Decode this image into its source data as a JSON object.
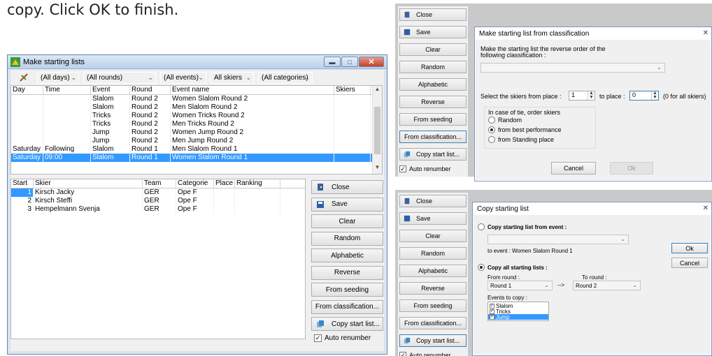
{
  "caption": "copy. Click OK to finish.",
  "main_window": {
    "title": "Make starting lists",
    "filters": [
      "(All days)",
      "(All rounds)",
      "(All events)",
      "All skiers",
      "(All categories)"
    ],
    "events_columns": [
      "Day",
      "Time",
      "Event",
      "Round",
      "Event name",
      "Skiers"
    ],
    "events_rows": [
      [
        "",
        "",
        "Slalom",
        "Round 2",
        "Women Slalom Round 2",
        ""
      ],
      [
        "",
        "",
        "Slalom",
        "Round 2",
        "Men Slalom Round 2",
        ""
      ],
      [
        "",
        "",
        "Tricks",
        "Round 2",
        "Women Tricks Round 2",
        ""
      ],
      [
        "",
        "",
        "Tricks",
        "Round 2",
        "Men Tricks Round 2",
        ""
      ],
      [
        "",
        "",
        "Jump",
        "Round 2",
        "Women Jump Round 2",
        ""
      ],
      [
        "",
        "",
        "Jump",
        "Round 2",
        "Men Jump Round 2",
        ""
      ],
      [
        "Saturday",
        "Following",
        "Slalom",
        "Round 1",
        "Men Slalom Round 1",
        ""
      ],
      [
        "Saturday",
        "09:00",
        "Slalom",
        "Round 1",
        "Women Slalom Round 1",
        ""
      ]
    ],
    "start_columns": [
      "Start",
      "Skier",
      "Team",
      "Categorie",
      "Place",
      "Ranking"
    ],
    "start_rows": [
      [
        "1",
        "Kirsch Jacky",
        "GER",
        "Ope F",
        "",
        ""
      ],
      [
        "2",
        "Kirsch Steffi",
        "GER",
        "Ope F",
        "",
        ""
      ],
      [
        "3",
        "Hempelmann Svenja",
        "GER",
        "Ope F",
        "",
        ""
      ]
    ],
    "buttons": {
      "close": "Close",
      "save": "Save",
      "clear": "Clear",
      "random": "Random",
      "alphabetic": "Alphabetic",
      "reverse": "Reverse",
      "from_seeding": "From seeding",
      "from_classification": "From classification...",
      "copy_start_list": "Copy start list..."
    },
    "auto_renumber": "Auto renumber"
  },
  "side_panel": {
    "close": "Close",
    "save": "Save",
    "clear": "Clear",
    "random": "Random",
    "alphabetic": "Alphabetic",
    "reverse": "Reverse",
    "from_seeding": "From seeding",
    "from_classification": "From classification...",
    "copy_start_list": "Copy start list...",
    "auto_renumber": "Auto renumber"
  },
  "classification_dialog": {
    "title": "Make starting list from classification",
    "instruction_line1": "Make the starting list the reverse order of the",
    "instruction_line2": "following classification :",
    "select_label": "Select the skiers from place :",
    "from_value": "1",
    "to_label": "to place :",
    "to_value": "0",
    "hint": "(0 for all skiers)",
    "tie_label": "In case of tie, order skiers",
    "options": [
      "Random",
      "from best performance",
      "from Standing place"
    ],
    "cancel": "Cancel",
    "ok": "Ok"
  },
  "copy_dialog": {
    "title": "Copy starting list",
    "opt1": "Copy starting list from event :",
    "to_event": "to event :  Women Slalom Round 1",
    "opt2": "Copy all starting lists :",
    "from_round_label": "From round :",
    "from_round": "Round 1",
    "arrow": "-->",
    "to_round_label": "To round :",
    "to_round": "Round 2",
    "events_label": "Events to copy :",
    "events": [
      "Slalom",
      "Tricks",
      "Jump"
    ],
    "ok": "Ok",
    "cancel": "Cancel"
  },
  "colors": {
    "selection": "#3399ff",
    "window_frame": "#d9e4f1"
  }
}
